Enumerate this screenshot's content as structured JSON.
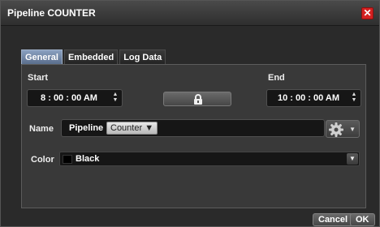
{
  "window": {
    "title": "Pipeline COUNTER",
    "close_label": "✕"
  },
  "tabs": [
    {
      "label": "General",
      "active": true
    },
    {
      "label": "Embedded",
      "active": false
    },
    {
      "label": "Log Data",
      "active": false
    }
  ],
  "start": {
    "label": "Start",
    "time": "8 : 00 : 00  AM"
  },
  "end": {
    "label": "End",
    "time": "10 : 00 : 00  AM"
  },
  "name": {
    "label": "Name",
    "pipeline_label": "Pipeline",
    "counter_label": "Counter ▼"
  },
  "color": {
    "label": "Color",
    "value": "Black",
    "swatch": "#000000"
  },
  "footer": {
    "cancel_label": "Cancel",
    "ok_label": "OK"
  },
  "icons": {
    "close": "close-icon",
    "lock": "lock-icon",
    "gear": "gear-icon",
    "spinner": "spinner-icon",
    "dropdown": "chevron-down-icon"
  }
}
